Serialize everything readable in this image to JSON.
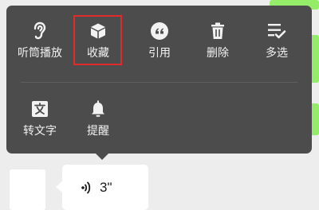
{
  "menu": {
    "row1": [
      {
        "label": "听筒播放",
        "icon": "ear-icon"
      },
      {
        "label": "收藏",
        "icon": "cube-icon"
      },
      {
        "label": "引用",
        "icon": "quote-icon"
      },
      {
        "label": "删除",
        "icon": "trash-icon"
      },
      {
        "label": "多选",
        "icon": "multi-select-icon"
      }
    ],
    "row2": [
      {
        "label": "转文字",
        "icon": "text-convert-icon"
      },
      {
        "label": "提醒",
        "icon": "bell-icon"
      }
    ]
  },
  "voice_message": {
    "duration": "3\""
  },
  "colors": {
    "menu_bg": "#4c4c4c",
    "highlight": "#e12a2a",
    "sent_bubble": "#95ec69"
  }
}
